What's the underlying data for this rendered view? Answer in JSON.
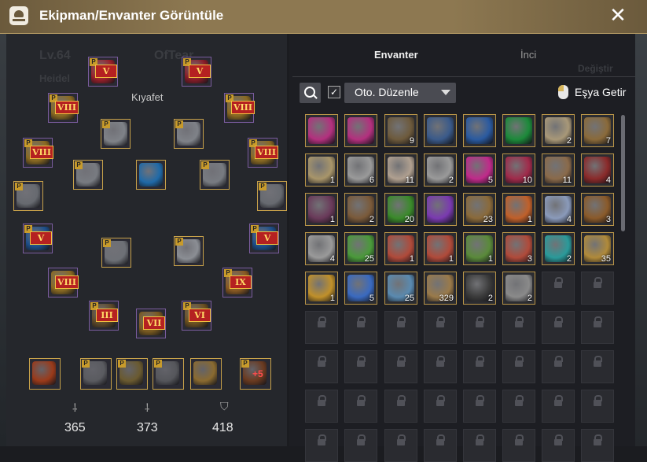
{
  "window": {
    "title": "Ekipman/Envanter Görüntüle",
    "close_glyph": "✕"
  },
  "character": {
    "level_text": "Lv.64",
    "name_text": "OfTear",
    "server_text": "Heidel",
    "section_label": "Kıyafet",
    "rank_text": "Değiştir"
  },
  "equipment": [
    {
      "name": "helmet-slot",
      "badge": "P",
      "tier": "V",
      "color": "#9a1f2a"
    },
    {
      "name": "helmet-alt-slot",
      "badge": "P",
      "tier": "V",
      "color": "#8a1c28"
    },
    {
      "name": "ring-left-slot",
      "badge": "P",
      "tier": "VIII",
      "color": "#8a6a22"
    },
    {
      "name": "ring-right-slot",
      "badge": "P",
      "tier": "VIII",
      "color": "#8a6a22"
    },
    {
      "name": "earring-left-slot",
      "badge": "P",
      "tier": "VIII",
      "color": "#8a6a22"
    },
    {
      "name": "earring-right-slot",
      "badge": "P",
      "tier": "VIII",
      "color": "#8a6a22"
    },
    {
      "name": "armor-left-slot",
      "badge": "P",
      "tier": "",
      "color": "#7f8288"
    },
    {
      "name": "armor-right-slot",
      "badge": "P",
      "tier": "",
      "color": "#7f8288"
    },
    {
      "name": "gloves-left-slot",
      "badge": "P",
      "tier": "",
      "color": "#787b81"
    },
    {
      "name": "gloves-right-slot",
      "badge": "P",
      "tier": "",
      "color": "#787b81"
    },
    {
      "name": "alchemy-stone-slot",
      "badge": "",
      "tier": "",
      "color": "#1f6aa8"
    },
    {
      "name": "shield-left-slot",
      "badge": "P",
      "tier": "",
      "color": "#676a70"
    },
    {
      "name": "shield-right-slot",
      "badge": "P",
      "tier": "",
      "color": "#676a70"
    },
    {
      "name": "mainhand-slot",
      "badge": "P",
      "tier": "V",
      "color": "#1d4f8a"
    },
    {
      "name": "offhand-slot",
      "badge": "P",
      "tier": "V",
      "color": "#1d4f8a"
    },
    {
      "name": "sword-slot",
      "badge": "P",
      "tier": "",
      "color": "#6d7076"
    },
    {
      "name": "emblem-slot",
      "badge": "P",
      "tier": "",
      "color": "#8b8e94"
    },
    {
      "name": "necklace-left-slot",
      "badge": "",
      "tier": "VIII",
      "color": "#8a6a22"
    },
    {
      "name": "belt-slot",
      "badge": "P",
      "tier": "IX",
      "color": "#8a5a22"
    },
    {
      "name": "dagger-slot",
      "badge": "P",
      "tier": "III",
      "color": "#5e4a2a"
    },
    {
      "name": "awakening-slot",
      "badge": "",
      "tier": "VII",
      "color": "#7a5a20"
    },
    {
      "name": "kutum-slot",
      "badge": "P",
      "tier": "VI",
      "color": "#6b5020"
    }
  ],
  "accessories": [
    {
      "name": "artifact-slot",
      "badge": "",
      "label": "",
      "color": "#9a3a1a"
    },
    {
      "name": "ring-artifact-slot",
      "badge": "P",
      "label": "",
      "color": "#5a5b60"
    },
    {
      "name": "glasses-slot",
      "badge": "P",
      "label": "",
      "color": "#6a5a30"
    },
    {
      "name": "earring-artifact-slot",
      "badge": "P",
      "label": "",
      "color": "#55565b"
    },
    {
      "name": "tool-slot",
      "badge": "",
      "label": "",
      "color": "#8a6a30"
    },
    {
      "name": "lifeskill-slot",
      "badge": "P",
      "label": "+5",
      "color": "#6a3a20"
    }
  ],
  "stats": [
    {
      "name": "ap-stat",
      "icon": "sword-icon",
      "glyph": "⸸",
      "value": "365"
    },
    {
      "name": "awakening-ap-stat",
      "icon": "awakening-icon",
      "glyph": "⸸",
      "value": "373"
    },
    {
      "name": "dp-stat",
      "icon": "shield-icon",
      "glyph": "⛉",
      "value": "418"
    }
  ],
  "tabs": [
    {
      "label": "Envanter",
      "active": true
    },
    {
      "label": "İnci",
      "active": false
    }
  ],
  "toolbar": {
    "sort_label": "Oto. Düzenle",
    "sort_checked": true,
    "fetch_label": "Eşya Getir"
  },
  "inventory": [
    {
      "icon": "magic-orb-icon",
      "count": "",
      "color": "#b3307e"
    },
    {
      "icon": "magic-orb-icon",
      "count": "",
      "color": "#b3307e"
    },
    {
      "icon": "weapon-crate-icon",
      "count": "9",
      "color": "#6d5a3c"
    },
    {
      "icon": "treasure-map-icon",
      "count": "",
      "color": "#3a5a8a"
    },
    {
      "icon": "blue-mace-icon",
      "count": "",
      "color": "#2a5aa0"
    },
    {
      "icon": "green-gem-icon",
      "count": "",
      "color": "#1c8a3a"
    },
    {
      "icon": "map-scroll-icon",
      "count": "2",
      "color": "#a89878"
    },
    {
      "icon": "old-map-icon",
      "count": "7",
      "color": "#8a6a3a"
    },
    {
      "icon": "paper-scroll-icon",
      "count": "1",
      "color": "#a8956a"
    },
    {
      "icon": "recipe-scroll-icon",
      "count": "6",
      "color": "#9a9a9a"
    },
    {
      "icon": "letter-icon",
      "count": "11",
      "color": "#b0a090"
    },
    {
      "icon": "recipe-scroll-icon",
      "count": "2",
      "color": "#9a9a9a"
    },
    {
      "icon": "pink-potion-icon",
      "count": "5",
      "color": "#c02a8a"
    },
    {
      "icon": "red-potion-icon",
      "count": "10",
      "color": "#a02a4a"
    },
    {
      "icon": "ore-icon",
      "count": "11",
      "color": "#8a6a4a"
    },
    {
      "icon": "elixir-icon",
      "count": "4",
      "color": "#8a2a2a"
    },
    {
      "icon": "book-icon",
      "count": "1",
      "color": "#6a3a5a"
    },
    {
      "icon": "chest-icon",
      "count": "2",
      "color": "#7a5a3a"
    },
    {
      "icon": "green-fire-icon",
      "count": "20",
      "color": "#3a8a2a"
    },
    {
      "icon": "purple-flame-icon",
      "count": "",
      "color": "#7a3ab0"
    },
    {
      "icon": "horn-icon",
      "count": "23",
      "color": "#8a6a3a"
    },
    {
      "icon": "orange-crystal-icon",
      "count": "1",
      "color": "#c0602a"
    },
    {
      "icon": "silver-box-icon",
      "count": "4",
      "color": "#8a9aba"
    },
    {
      "icon": "bronze-horn-icon",
      "count": "3",
      "color": "#8a5a2a"
    },
    {
      "icon": "feather-icon",
      "count": "4",
      "color": "#9a9a9a"
    },
    {
      "icon": "green-leaf-icon",
      "count": "25",
      "color": "#4a9a3a"
    },
    {
      "icon": "red-scroll-icon",
      "count": "1",
      "color": "#b04a3a"
    },
    {
      "icon": "red-scroll-icon",
      "count": "1",
      "color": "#b04a3a"
    },
    {
      "icon": "green-scroll-icon",
      "count": "1",
      "color": "#5a8a3a"
    },
    {
      "icon": "red-scroll-icon",
      "count": "3",
      "color": "#b04a3a"
    },
    {
      "icon": "teal-orb-icon",
      "count": "2",
      "color": "#2a9a9a"
    },
    {
      "icon": "gold-shard-icon",
      "count": "35",
      "color": "#b08a3a"
    },
    {
      "icon": "gold-crystal-icon",
      "count": "1",
      "color": "#c0902a"
    },
    {
      "icon": "blue-bottle-icon",
      "count": "5",
      "color": "#3a6ac0"
    },
    {
      "icon": "blue-vial-icon",
      "count": "25",
      "color": "#5a8ab0"
    },
    {
      "icon": "mirror-icon",
      "count": "329",
      "color": "#9a7a4a"
    },
    {
      "icon": "dark-fragment-icon",
      "count": "2",
      "color": "#3a3a3a"
    },
    {
      "icon": "stone-icon",
      "count": "2",
      "color": "#8a8a8a"
    }
  ],
  "locked_slots": 34
}
